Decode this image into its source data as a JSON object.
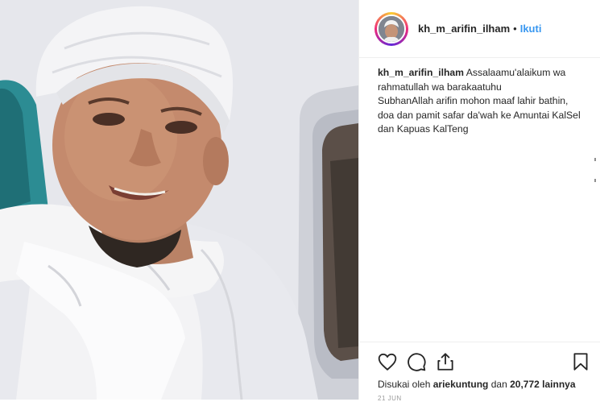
{
  "post": {
    "username": "kh_m_arifin_ilham",
    "follow_label": "Ikuti",
    "separator": "•",
    "caption_lines": [
      "Assalaamu'alaikum wa",
      "rahmatullah wa barakaatuhu",
      "SubhanAllah arifin mohon maaf lahir bathin,",
      "doa dan pamit safar da'wah ke Amuntai KalSel",
      "dan Kapuas KalTeng"
    ],
    "likes": {
      "prefix": "Disukai oleh",
      "user": "ariekuntung",
      "middle": "dan",
      "count": "20,772",
      "suffix": "lainnya"
    },
    "date": "21 JUN"
  },
  "icons": [
    "heart-icon",
    "comment-icon",
    "share-icon",
    "bookmark-icon"
  ],
  "colors": {
    "follow_blue": "#3897f0",
    "text": "#262626",
    "border": "#efefef"
  }
}
